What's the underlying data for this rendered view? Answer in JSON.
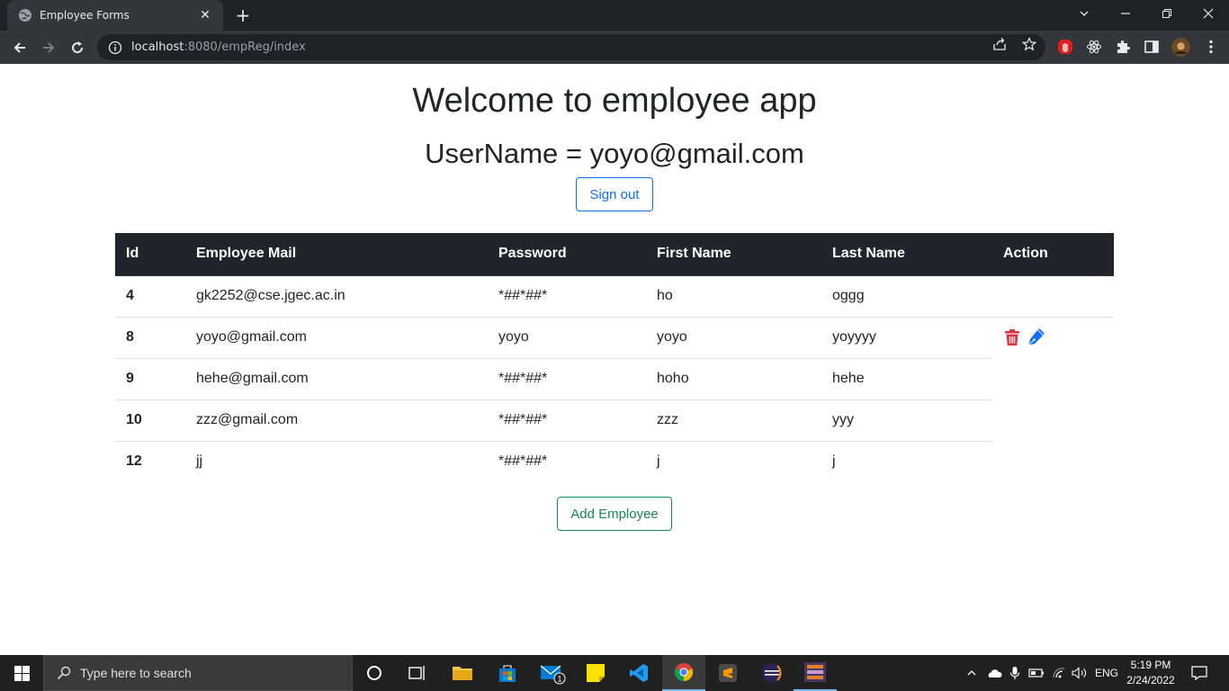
{
  "browser": {
    "tab_title": "Employee Forms",
    "tab_close": "✕",
    "new_tab": "+",
    "url_host": "localhost",
    "url_rest": ":8080/empReg/index"
  },
  "page": {
    "heading": "Welcome to employee app",
    "username_line": "UserName = yoyo@gmail.com",
    "sign_out_label": "Sign out",
    "add_employee_label": "Add Employee"
  },
  "table": {
    "headers": [
      "Id",
      "Employee Mail",
      "Password",
      "First Name",
      "Last Name",
      "Action"
    ],
    "rows": [
      {
        "id": "4",
        "mail": "gk2252@cse.jgec.ac.in",
        "password": "*##*##*",
        "first": "ho",
        "last": "oggg"
      },
      {
        "id": "8",
        "mail": "yoyo@gmail.com",
        "password": "yoyo",
        "first": "yoyo",
        "last": "yoyyyy"
      },
      {
        "id": "9",
        "mail": "hehe@gmail.com",
        "password": "*##*##*",
        "first": "hoho",
        "last": "hehe"
      },
      {
        "id": "10",
        "mail": "zzz@gmail.com",
        "password": "*##*##*",
        "first": "zzz",
        "last": "yyy"
      },
      {
        "id": "12",
        "mail": "jj",
        "password": "*##*##*",
        "first": "j",
        "last": "j"
      }
    ],
    "action_row_index": 1,
    "icons": {
      "delete": "trash-icon",
      "edit": "pen-icon"
    },
    "colors": {
      "delete": "#dc3545",
      "edit": "#0d6efd"
    }
  },
  "taskbar": {
    "search_placeholder": "Type here to search",
    "language": "ENG",
    "time": "5:19 PM",
    "date": "2/24/2022",
    "mail_badge": "1"
  },
  "colors": {
    "primary": "#0d6efd",
    "success": "#198754",
    "table_header": "#212529"
  }
}
